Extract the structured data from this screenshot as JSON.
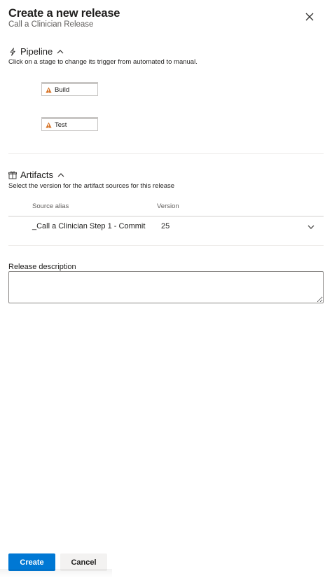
{
  "header": {
    "title": "Create a new release",
    "subtitle": "Call a Clinician Release"
  },
  "pipeline": {
    "label": "Pipeline",
    "description": "Click on a stage to change its trigger from automated to manual.",
    "stages": [
      {
        "name": "Build",
        "status": "warning"
      },
      {
        "name": "Test",
        "status": "warning"
      }
    ]
  },
  "artifacts": {
    "label": "Artifacts",
    "description": "Select the version for the artifact sources for this release",
    "columns": {
      "source_alias": "Source alias",
      "version": "Version"
    },
    "rows": [
      {
        "source_alias": "_Call a Clinician Step 1 - Commit",
        "version": "25"
      }
    ]
  },
  "release_description": {
    "label": "Release description",
    "value": ""
  },
  "footer": {
    "create_label": "Create",
    "cancel_label": "Cancel"
  },
  "colors": {
    "primary": "#0078d4",
    "warning": "#d8762b",
    "secondary_button": "#f3f2f1"
  },
  "icons": {
    "close": "close-icon",
    "pipeline": "lightning-icon",
    "artifacts": "package-icon",
    "collapse": "chevron-up-icon",
    "dropdown": "chevron-down-icon",
    "warning": "warning-icon"
  }
}
